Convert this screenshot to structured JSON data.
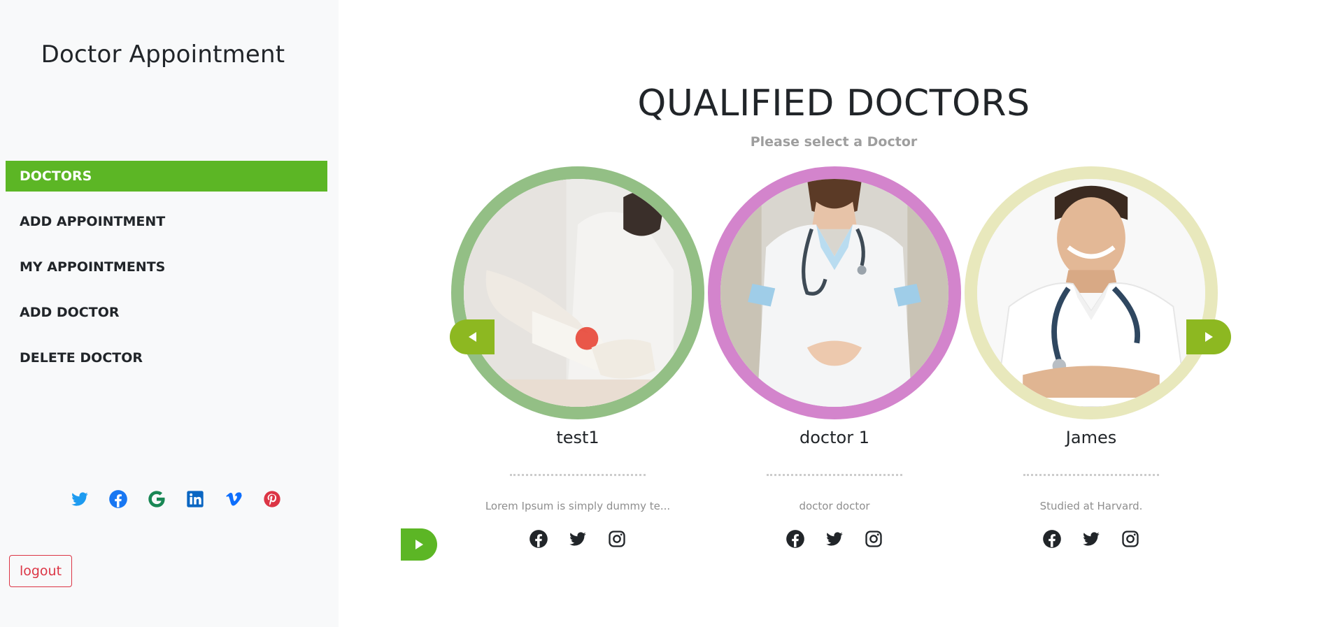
{
  "sidebar": {
    "title": "Doctor Appointment",
    "nav": [
      {
        "label": "DOCTORS",
        "active": true
      },
      {
        "label": "ADD APPOINTMENT",
        "active": false
      },
      {
        "label": "MY APPOINTMENTS",
        "active": false
      },
      {
        "label": "ADD DOCTOR",
        "active": false
      },
      {
        "label": "DELETE DOCTOR",
        "active": false
      }
    ],
    "social_icons": [
      "twitter-icon",
      "facebook-icon",
      "google-icon",
      "linkedin-icon",
      "vimeo-icon",
      "pinterest-icon"
    ],
    "logout_label": "logout"
  },
  "main": {
    "heading": "QUALIFIED DOCTORS",
    "subheading": "Please select a Doctor",
    "doctors": [
      {
        "name": "test1",
        "description": "Lorem Ipsum is simply dummy te...",
        "ring_color": "#93bf85"
      },
      {
        "name": "doctor 1",
        "description": "doctor doctor",
        "ring_color": "#d384cc"
      },
      {
        "name": "James",
        "description": "Studied at Harvard.",
        "ring_color": "#e8e8bc"
      }
    ],
    "doctor_social_icons": [
      "facebook-icon",
      "twitter-icon",
      "instagram-icon"
    ]
  },
  "colors": {
    "accent_green": "#5cb625",
    "arrow_green": "#8db821",
    "danger": "#dc3545",
    "sidebar_bg": "#f8f9fa"
  }
}
